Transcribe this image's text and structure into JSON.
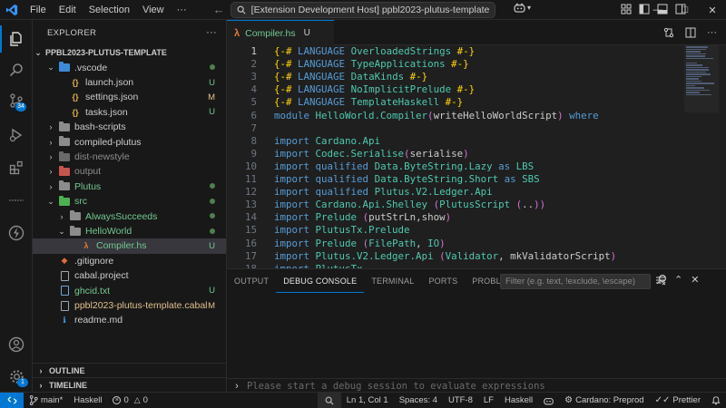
{
  "titlebar": {
    "menu": [
      "File",
      "Edit",
      "Selection",
      "View",
      "···"
    ],
    "search_text": "[Extension Development Host] ppbl2023-plutus-template"
  },
  "activitybar": {
    "items": [
      "explorer-icon",
      "search-icon",
      "source-control-icon",
      "run-debug-icon",
      "extensions-icon",
      "remote-icon",
      "haskell-icon",
      "accounts-icon",
      "manage-icon"
    ],
    "source_control_badge": "34",
    "manage_badge": "1"
  },
  "sidebar": {
    "title": "EXPLORER",
    "more": "···",
    "root": "PPBL2023-PLUTUS-TEMPLATE",
    "tree": [
      {
        "label": ".vscode",
        "status": "dot",
        "color": "#c5c5c5"
      },
      {
        "label": "launch.json",
        "status": "U",
        "color": "#cccccc"
      },
      {
        "label": "settings.json",
        "status": "M",
        "color": "#cccccc"
      },
      {
        "label": "tasks.json",
        "status": "U",
        "color": "#cccccc"
      },
      {
        "label": "bash-scripts",
        "status": "",
        "color": "#cccccc"
      },
      {
        "label": "compiled-plutus",
        "status": "",
        "color": "#cccccc"
      },
      {
        "label": "dist-newstyle",
        "status": "",
        "color": "#8c8c8c"
      },
      {
        "label": "output",
        "status": "",
        "color": "#8c8c8c"
      },
      {
        "label": "Plutus",
        "status": "dot",
        "color": "#73c991"
      },
      {
        "label": "src",
        "status": "dot",
        "color": "#73c991"
      },
      {
        "label": "AlwaysSucceeds",
        "status": "dot",
        "color": "#73c991"
      },
      {
        "label": "HelloWorld",
        "status": "dot",
        "color": "#73c991"
      },
      {
        "label": "Compiler.hs",
        "status": "U",
        "color": "#73c991"
      },
      {
        "label": ".gitignore",
        "status": "",
        "color": "#cccccc"
      },
      {
        "label": "cabal.project",
        "status": "",
        "color": "#cccccc"
      },
      {
        "label": "ghcid.txt",
        "status": "U",
        "color": "#73c991"
      },
      {
        "label": "ppbl2023-plutus-template.cabal",
        "status": "M",
        "color": "#e2c08d"
      },
      {
        "label": "readme.md",
        "status": "",
        "color": "#cccccc"
      }
    ],
    "sections": [
      "OUTLINE",
      "TIMELINE"
    ]
  },
  "editor": {
    "tab": {
      "label": "Compiler.hs",
      "status": "U"
    },
    "lines": [
      {
        "n": "1",
        "text": "{-# LANGUAGE OverloadedStrings #-}"
      },
      {
        "n": "2",
        "text": "{-# LANGUAGE TypeApplications #-}"
      },
      {
        "n": "3",
        "text": "{-# LANGUAGE DataKinds #-}"
      },
      {
        "n": "4",
        "text": "{-# LANGUAGE NoImplicitPrelude #-}"
      },
      {
        "n": "5",
        "text": "{-# LANGUAGE TemplateHaskell #-}"
      },
      {
        "n": "6",
        "text": "module HelloWorld.Compiler(writeHelloWorldScript) where"
      },
      {
        "n": "7",
        "text": ""
      },
      {
        "n": "8",
        "text": "import Cardano.Api"
      },
      {
        "n": "9",
        "text": "import Codec.Serialise(serialise)"
      },
      {
        "n": "10",
        "text": "import qualified Data.ByteString.Lazy as LBS"
      },
      {
        "n": "11",
        "text": "import qualified Data.ByteString.Short as SBS"
      },
      {
        "n": "12",
        "text": "import qualified Plutus.V2.Ledger.Api"
      },
      {
        "n": "13",
        "text": "import Cardano.Api.Shelley (PlutusScript (..))"
      },
      {
        "n": "14",
        "text": "import Prelude (putStrLn,show)"
      },
      {
        "n": "15",
        "text": "import PlutusTx.Prelude"
      },
      {
        "n": "16",
        "text": "import Prelude (FilePath, IO)"
      },
      {
        "n": "17",
        "text": "import Plutus.V2.Ledger.Api (Validator, mkValidatorScript)"
      },
      {
        "n": "18",
        "text": "import PlutusTx"
      }
    ]
  },
  "panel": {
    "tabs": [
      "OUTPUT",
      "DEBUG CONSOLE",
      "TERMINAL",
      "PORTS",
      "PROBLEMS"
    ],
    "active_tab": "DEBUG CONSOLE",
    "filter_placeholder": "Filter (e.g. text, !exclude, \\escape)",
    "console_placeholder": "Please start a debug session to evaluate expressions"
  },
  "statusbar": {
    "branch": "main*",
    "language_server": "Haskell",
    "errors": "0",
    "warnings": "0",
    "cursor": "Ln 1, Col 1",
    "spaces": "Spaces: 4",
    "encoding": "UTF-8",
    "eol": "LF",
    "language": "Haskell",
    "network": "Cardano: Preprod",
    "prettier": "Prettier"
  },
  "colors": {
    "accent": "#0078d4",
    "untracked": "#73c991",
    "modified": "#e2c08d",
    "haskell_icon": "#e37933"
  }
}
